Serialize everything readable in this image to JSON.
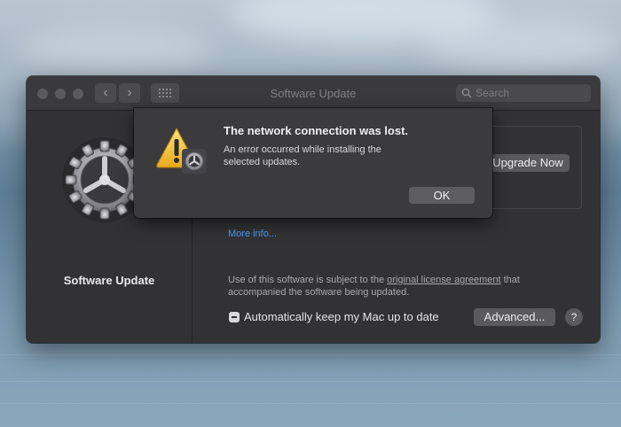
{
  "window": {
    "title": "Software Update",
    "search_placeholder": "Search",
    "nav_back": "‹",
    "nav_forward": "›"
  },
  "sidebar": {
    "label": "Software Update",
    "icon": "gear-icon"
  },
  "main": {
    "upgrade_button": "Upgrade Now",
    "more_info": "More info...",
    "license_prefix": "Use of this software is subject to the ",
    "license_link": "original license agreement",
    "license_suffix": " that accompanied the software being updated.",
    "auto_update_label": "Automatically keep my Mac up to date",
    "advanced_button": "Advanced...",
    "help_button": "?"
  },
  "alert": {
    "title": "The network connection was lost.",
    "message": "An error occurred while installing the selected updates.",
    "ok_button": "OK",
    "icon": "warning-icon"
  },
  "colors": {
    "window_bg": "#323234",
    "accent_link": "#4b9ef6",
    "warning_yellow": "#f6c744"
  }
}
